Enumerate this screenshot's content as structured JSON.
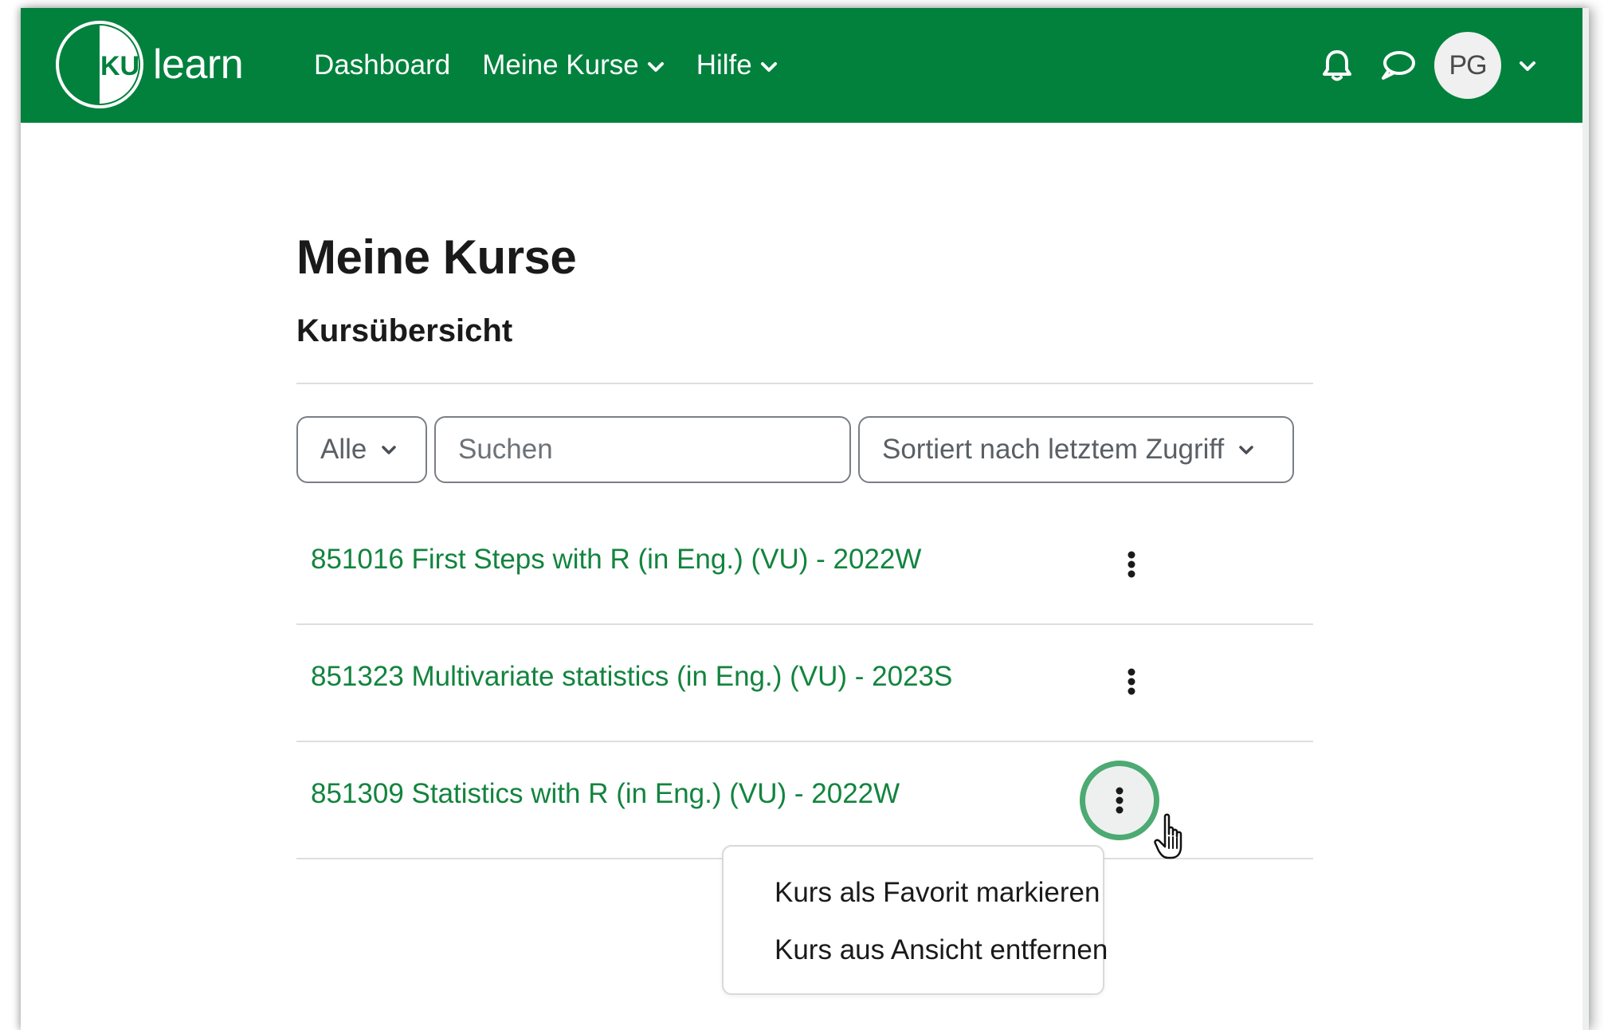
{
  "navbar": {
    "brand_logo_text": "BOKU",
    "brand_text": "learn",
    "links": [
      {
        "label": "Dashboard",
        "has_dropdown": false
      },
      {
        "label": "Meine Kurse",
        "has_dropdown": true
      },
      {
        "label": "Hilfe",
        "has_dropdown": true
      }
    ],
    "notifications_icon": "bell-icon",
    "messages_icon": "chat-bubble-icon",
    "user_initials": "PG",
    "background_color": "#02813d"
  },
  "main": {
    "page_title": "Meine Kurse",
    "section_title": "Kursübersicht",
    "filter": {
      "selected": "Alle"
    },
    "search": {
      "placeholder": "Suchen",
      "value": ""
    },
    "sort": {
      "selected": "Sortiert nach letztem Zugriff"
    },
    "courses": [
      {
        "title": "851016 First Steps with R (in Eng.) (VU) - 2022W"
      },
      {
        "title": "851323 Multivariate statistics (in Eng.) (VU) - 2023S"
      },
      {
        "title": "851309 Statistics with R (in Eng.) (VU) - 2022W"
      }
    ],
    "course_actions_menu": {
      "open_for_course_index": 2,
      "items": [
        "Kurs als Favorit markieren",
        "Kurs aus Ansicht entfernen"
      ]
    },
    "link_color": "#12843e",
    "focus_ring_color": "#4caa72"
  }
}
